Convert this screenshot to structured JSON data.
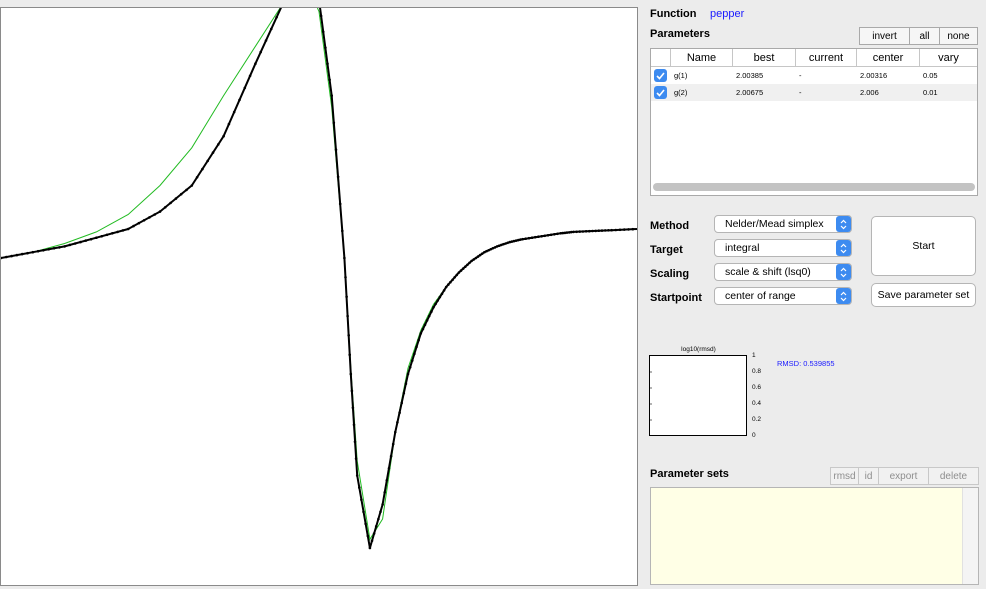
{
  "function": {
    "label": "Function",
    "value": "pepper"
  },
  "parameters": {
    "title": "Parameters",
    "buttons": [
      "invert",
      "all",
      "none"
    ],
    "columns": [
      "",
      "Name",
      "best",
      "current",
      "center",
      "vary"
    ],
    "rows": [
      {
        "checked": true,
        "name": "g(1)",
        "best": "2.00385",
        "current": "-",
        "center": "2.00316",
        "vary": "0.05"
      },
      {
        "checked": true,
        "name": "g(2)",
        "best": "2.00675",
        "current": "-",
        "center": "2.006",
        "vary": "0.01"
      }
    ]
  },
  "settings": {
    "method": {
      "label": "Method",
      "value": "Nelder/Mead simplex"
    },
    "target": {
      "label": "Target",
      "value": "integral"
    },
    "scaling": {
      "label": "Scaling",
      "value": "scale & shift (lsq0)"
    },
    "startpoint": {
      "label": "Startpoint",
      "value": "center of range"
    }
  },
  "actions": {
    "start": "Start",
    "save": "Save parameter set"
  },
  "rmsd_plot": {
    "title": "log10(rmsd)",
    "yticks": [
      "1",
      "0.8",
      "0.6",
      "0.4",
      "0.2",
      "0"
    ],
    "rmsd_text": "RMSD: 0.539855"
  },
  "parameter_sets": {
    "title": "Parameter sets",
    "buttons": [
      "rmsd",
      "id",
      "export",
      "delete"
    ]
  },
  "colors": {
    "accent": "#3d8bf0",
    "fit_line": "#22bb22",
    "data_line": "#000000",
    "link_blue": "#1a1aff",
    "sets_bg": "#ffffe6"
  },
  "chart_data": {
    "type": "line",
    "title": "",
    "xlabel": "",
    "ylabel": "",
    "xlim": [
      0,
      1
    ],
    "ylim": [
      -1,
      1
    ],
    "series": [
      {
        "x": [
          0,
          0.05,
          0.1,
          0.15,
          0.2,
          0.25,
          0.3,
          0.35,
          0.4,
          0.45,
          0.48,
          0.5,
          0.52,
          0.54,
          0.55,
          0.56,
          0.58,
          0.6,
          0.62,
          0.64,
          0.66,
          0.68,
          0.7,
          0.72,
          0.74,
          0.76,
          0.78,
          0.8,
          0.82,
          0.85,
          0.88,
          0.9,
          0.93,
          0.96,
          1.0
        ],
        "y": [
          0.0,
          0.02,
          0.04,
          0.07,
          0.1,
          0.16,
          0.25,
          0.42,
          0.67,
          0.91,
          0.95,
          0.89,
          0.56,
          0.0,
          -0.4,
          -0.75,
          -1.0,
          -0.85,
          -0.6,
          -0.4,
          -0.26,
          -0.17,
          -0.1,
          -0.05,
          -0.01,
          0.02,
          0.04,
          0.055,
          0.065,
          0.075,
          0.085,
          0.09,
          0.093,
          0.096,
          0.1
        ]
      },
      {
        "x": [
          0,
          0.05,
          0.1,
          0.15,
          0.2,
          0.25,
          0.3,
          0.35,
          0.4,
          0.45,
          0.48,
          0.5,
          0.52,
          0.54,
          0.55,
          0.56,
          0.58,
          0.6,
          0.62,
          0.64,
          0.66,
          0.68,
          0.7,
          0.72,
          0.74,
          0.76,
          0.78,
          0.8,
          0.82,
          0.85,
          0.88,
          0.9,
          0.93,
          0.96,
          1.0
        ],
        "y": [
          0.0,
          0.02,
          0.05,
          0.09,
          0.15,
          0.25,
          0.38,
          0.56,
          0.73,
          0.9,
          0.95,
          0.85,
          0.52,
          0.0,
          -0.38,
          -0.7,
          -0.97,
          -0.9,
          -0.6,
          -0.38,
          -0.25,
          -0.16,
          -0.1,
          -0.05,
          -0.01,
          0.02,
          0.04,
          0.055,
          0.065,
          0.075,
          0.085,
          0.09,
          0.093,
          0.096,
          0.1
        ]
      }
    ]
  }
}
